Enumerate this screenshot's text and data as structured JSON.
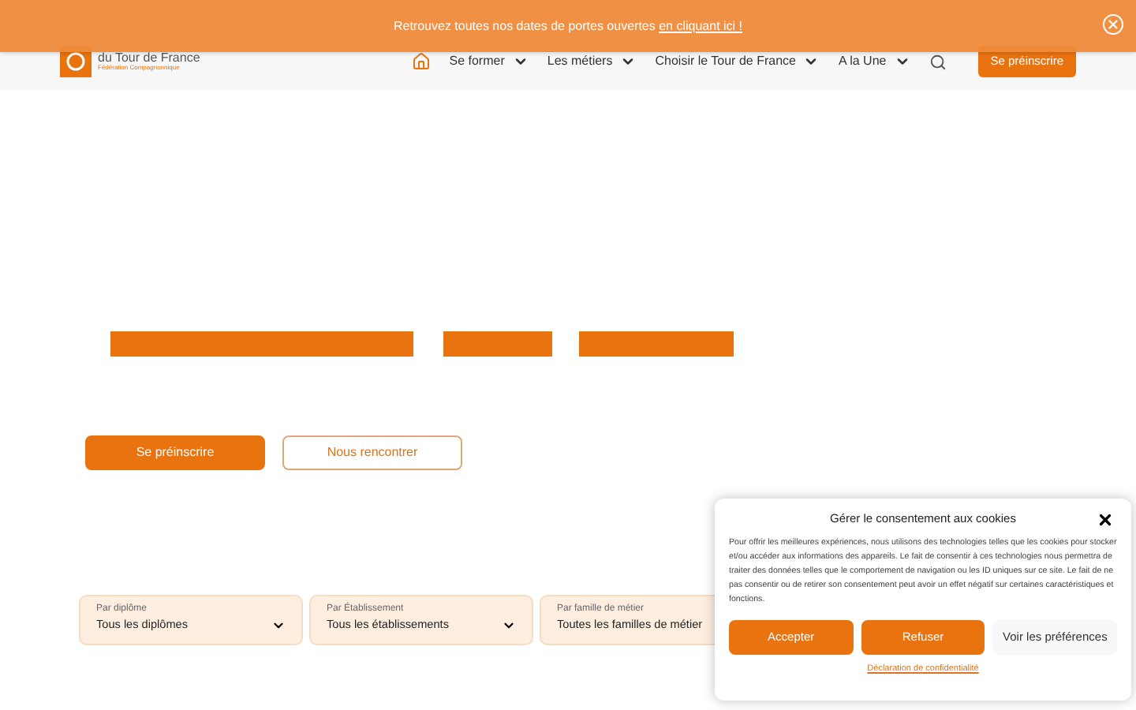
{
  "banner": {
    "text": "Retrouvez toutes nos dates de portes ouvertes",
    "link": "en cliquant ici !"
  },
  "logo": {
    "line_1": "du Tour de France",
    "line_2": "Fédération Compagnonnique"
  },
  "nav": {
    "items": [
      {
        "label": "Se former"
      },
      {
        "label": "Les métiers"
      },
      {
        "label": "Choisir le Tour de France"
      },
      {
        "label": "A la Une"
      }
    ],
    "cta": "Se préinscrire"
  },
  "hero": {
    "buttons": [
      {
        "label": "Se préinscrire",
        "kind": "primary"
      },
      {
        "label": "Nous rencontrer",
        "kind": "outline"
      }
    ]
  },
  "filters": [
    {
      "label": "Par diplôme",
      "value": "Tous les diplômes"
    },
    {
      "label": "Par Établissement",
      "value": "Tous les établissements"
    },
    {
      "label": "Par famille de métier",
      "value": "Toutes les familles de métier"
    }
  ],
  "cookie_dialog": {
    "title": "Gérer le consentement aux cookies",
    "body": "Pour offrir les meilleures expériences, nous utilisons des technologies telles que les cookies pour stocker et/ou accéder aux informations des appareils. Le fait de consentir à ces technologies nous permettra de traiter des données telles que le comportement de navigation ou les ID uniques sur ce site. Le fait de ne pas consentir ou de retirer son consentement peut avoir un effet négatif sur certaines caractéristiques et fonctions.",
    "buttons": [
      {
        "label": "Accepter",
        "kind": "primary"
      },
      {
        "label": "Refuser",
        "kind": "primary"
      },
      {
        "label": "Voir les préférences",
        "kind": "secondary"
      }
    ],
    "link": "Déclaration de confidentialité"
  }
}
